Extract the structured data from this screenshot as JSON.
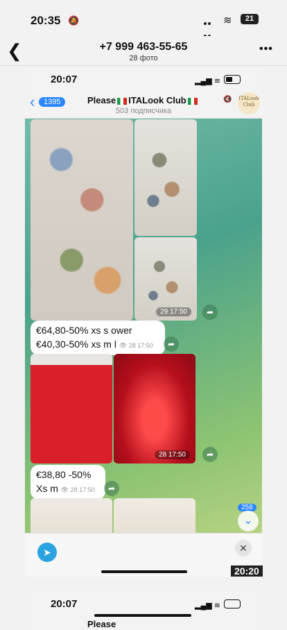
{
  "status_bar": {
    "time": "20:35",
    "battery": "21"
  },
  "header": {
    "phone": "+7 999 463-55-65",
    "subtitle": "28 фото"
  },
  "inner": {
    "time": "20:07",
    "back_count": "1395",
    "channel_name_a": "Please",
    "channel_name_b": "ITALook Club",
    "subscribers": "503 подписчика",
    "avatar_text": "ITALook Club",
    "messages": [
      {
        "timestamp": "29 17:50"
      },
      {
        "lines": [
          "€64,80-50% xs s ower",
          "€40,30-50% xs m l"
        ],
        "views": "28 17:50"
      },
      {
        "timestamp": "28 17:50"
      },
      {
        "lines": [
          "€38,80 -50%",
          "Xs m"
        ],
        "views": "28 17:50"
      }
    ],
    "unread": "258"
  },
  "card": {
    "time": "20:20"
  },
  "preview2": {
    "time": "20:07",
    "channel_name": "Please"
  },
  "colors": {
    "accent": "#2b86ff",
    "telegram": "#2aa3e0"
  }
}
